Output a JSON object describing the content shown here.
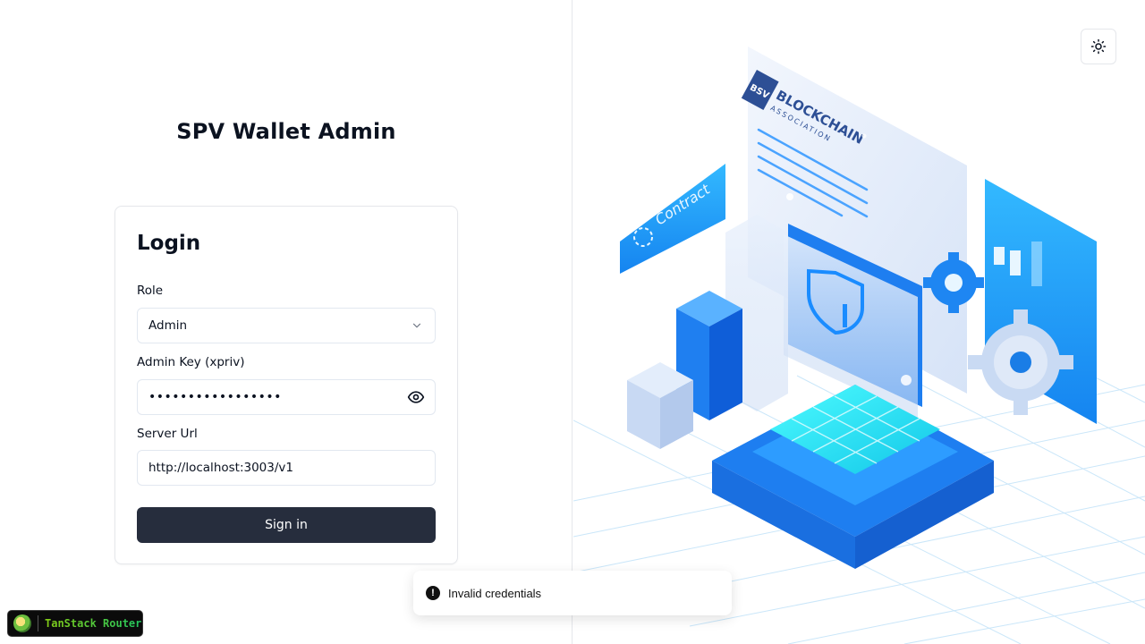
{
  "app_title": "SPV Wallet Admin",
  "login": {
    "title": "Login",
    "role_label": "Role",
    "role_value": "Admin",
    "key_label": "Admin Key (xpriv)",
    "key_value": "•••••••••••••••••",
    "server_label": "Server Url",
    "server_value": "http://localhost:3003/v1",
    "signin_label": "Sign in"
  },
  "toast": {
    "message": "Invalid credentials",
    "icon": "alert-circle-icon"
  },
  "devtools": {
    "label": "TanStack Router"
  },
  "illustration": {
    "brand_text": "BSV",
    "brand_title": "BLOCKCHAIN",
    "brand_subtitle": "ASSOCIATION",
    "contract_label": "Contract"
  },
  "colors": {
    "primary_button": "#262d3d",
    "accent_blue": "#1a8cff",
    "accent_cyan": "#22e6f5"
  }
}
